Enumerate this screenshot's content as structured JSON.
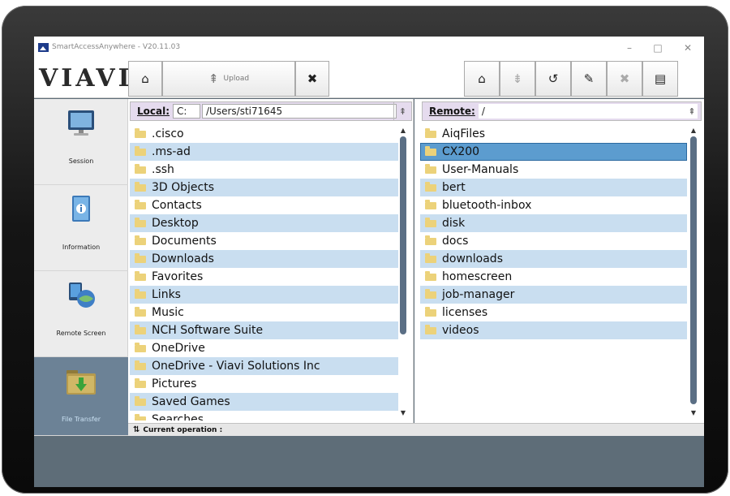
{
  "window": {
    "title": "SmartAccessAnywhere - V20.11.03",
    "minimize": "–",
    "maximize": "□",
    "close": "✕"
  },
  "brand": {
    "logo": "VIAVI"
  },
  "toolbar": {
    "local": {
      "home_icon": "⌂",
      "upload_icon": "⇞",
      "upload_label": "Upload",
      "delete_icon": "✖"
    },
    "remote": {
      "home_icon": "⌂",
      "download_icon": "⇟",
      "refresh_icon": "↺",
      "rename_icon": "✎",
      "delete_icon": "✖",
      "new_folder_icon": "▤"
    }
  },
  "sidebar": {
    "items": [
      {
        "label": "Session",
        "icon": "monitor-icon"
      },
      {
        "label": "Information",
        "icon": "info-book-icon"
      },
      {
        "label": "Remote Screen",
        "icon": "remote-screen-icon"
      },
      {
        "label": "File Transfer",
        "icon": "folder-download-icon",
        "active": true
      }
    ]
  },
  "local": {
    "label": "Local:",
    "drive": "C:",
    "path": "/Users/sti71645",
    "collapse_icon": "⇞",
    "items": [
      ".cisco",
      ".ms-ad",
      ".ssh",
      "3D Objects",
      "Contacts",
      "Desktop",
      "Documents",
      "Downloads",
      "Favorites",
      "Links",
      "Music",
      "NCH Software Suite",
      "OneDrive",
      "OneDrive - Viavi Solutions Inc",
      "Pictures",
      "Saved Games",
      "Searches"
    ]
  },
  "remote": {
    "label": "Remote:",
    "path": "/",
    "collapse_icon": "⇞",
    "selected": "CX200",
    "items": [
      "AiqFiles",
      "CX200",
      "User-Manuals",
      "bert",
      "bluetooth-inbox",
      "disk",
      "docs",
      "downloads",
      "homescreen",
      "job-manager",
      "licenses",
      "videos"
    ]
  },
  "status": {
    "icon": "⇅",
    "label": "Current operation :"
  },
  "colors": {
    "accent_row": "#c9def0",
    "selected_row": "#5c9ccf",
    "path_bar": "#e5dbee",
    "sidebar_active": "#6c8296",
    "bezel": "#151515"
  }
}
